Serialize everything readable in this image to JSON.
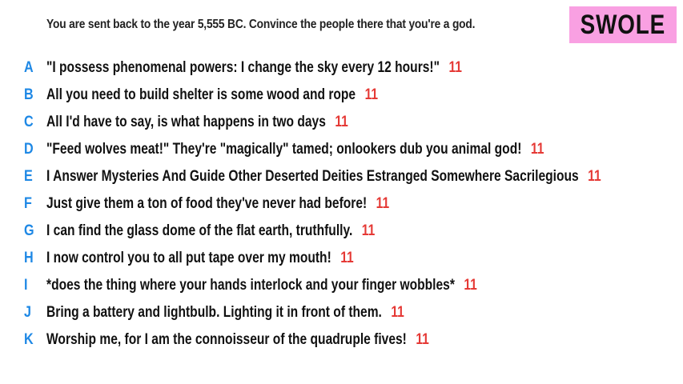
{
  "prompt": "You are sent back to the year 5,555 BC. Convince the people there that you're a god.",
  "badge": {
    "label": "SWOLE",
    "color": "#f9a0e2"
  },
  "colors": {
    "letter": "#1e88e5",
    "score": "#e53935",
    "text": "#111111"
  },
  "answers": [
    {
      "letter": "A",
      "text": "\"I possess phenomenal powers: I change the sky every 12 hours!\"",
      "score": "11"
    },
    {
      "letter": "B",
      "text": "All you need to build shelter is some wood and rope",
      "score": "11"
    },
    {
      "letter": "C",
      "text": "All I'd have to say, is what happens in two days",
      "score": "11"
    },
    {
      "letter": "D",
      "text": "\"Feed wolves meat!\" They're \"magically\" tamed; onlookers dub you animal god!",
      "score": "11"
    },
    {
      "letter": "E",
      "text": "I Answer Mysteries And Guide Other Deserted Deities Estranged Somewhere Sacrilegious",
      "score": "11"
    },
    {
      "letter": "F",
      "text": "Just give them a ton of food they've never had before!",
      "score": "11"
    },
    {
      "letter": "G",
      "text": "I can find the glass dome of the flat earth, truthfully.",
      "score": "11"
    },
    {
      "letter": "H",
      "text": "I now control you to all put tape over my mouth!",
      "score": "11"
    },
    {
      "letter": "I",
      "text": "*does the thing where your hands interlock and your finger wobbles*",
      "score": "11"
    },
    {
      "letter": "J",
      "text": "Bring a battery and lightbulb. Lighting it in front of them.",
      "score": "11"
    },
    {
      "letter": "K",
      "text": "Worship me, for I am the connoisseur of the quadruple fives!",
      "score": "11"
    }
  ]
}
